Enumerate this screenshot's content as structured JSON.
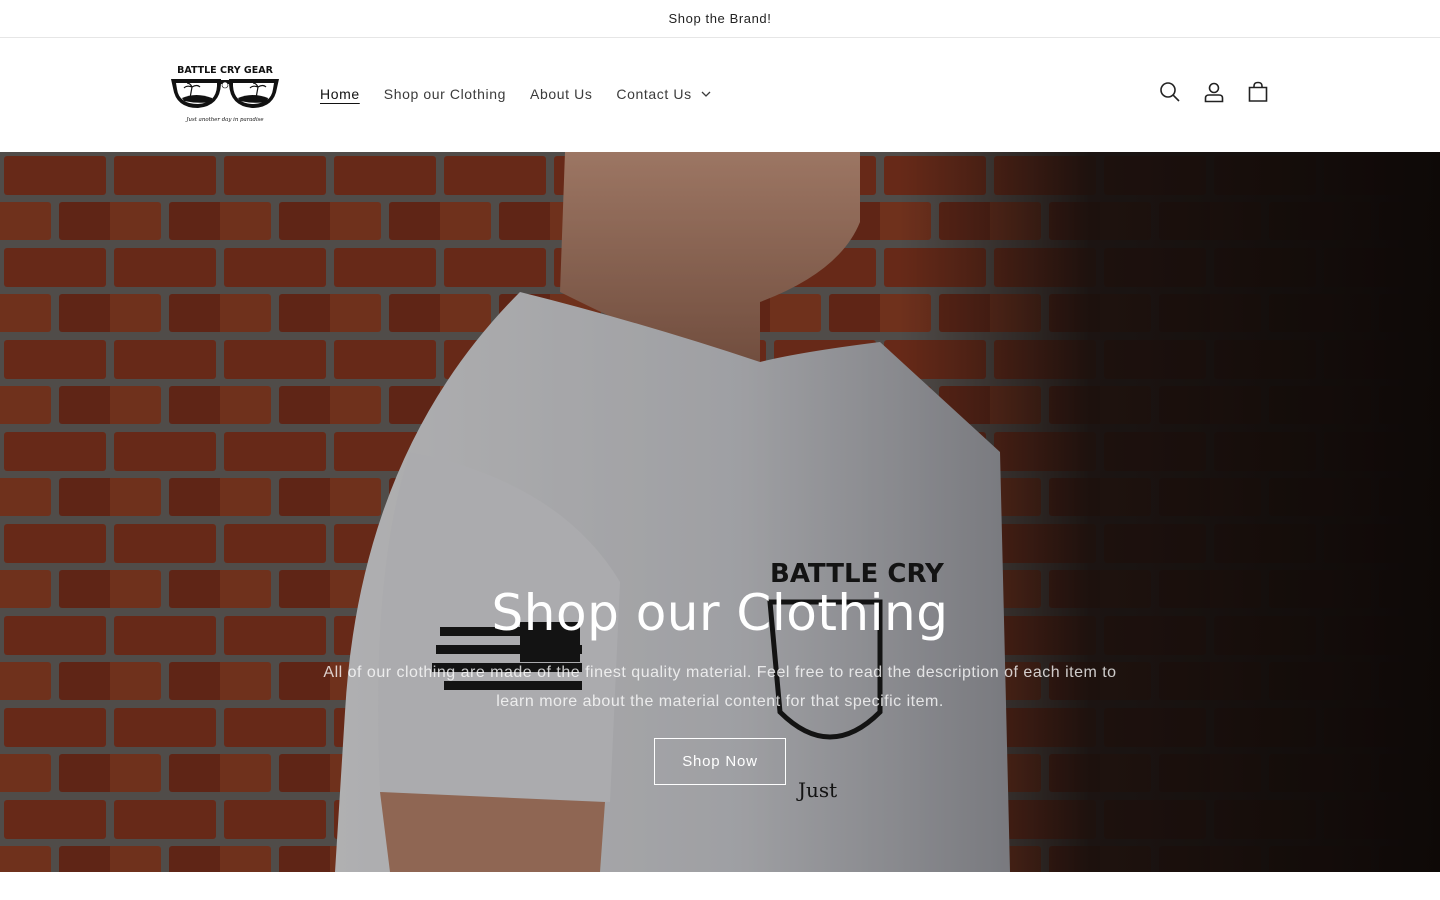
{
  "announcement": {
    "text": "Shop the Brand!"
  },
  "brand": {
    "name": "BATTLE CRY GEAR",
    "tagline": "Just another day in paradise"
  },
  "nav": {
    "items": [
      {
        "label": "Home",
        "active": true
      },
      {
        "label": "Shop our Clothing",
        "active": false
      },
      {
        "label": "About Us",
        "active": false
      },
      {
        "label": "Contact Us",
        "active": false,
        "has_dropdown": true
      }
    ]
  },
  "header_icons": [
    "search-icon",
    "account-icon",
    "cart-icon"
  ],
  "hero": {
    "title": "Shop our Clothing",
    "text": "All of our clothing are made of the finest quality material. Feel free to read the description of each item to learn more about the material content for that specific item.",
    "button_label": "Shop Now"
  },
  "colors": {
    "text": "#121212",
    "border": "#e6e6e6",
    "hero_overlay": "rgba(0,0,0,0.28)"
  }
}
